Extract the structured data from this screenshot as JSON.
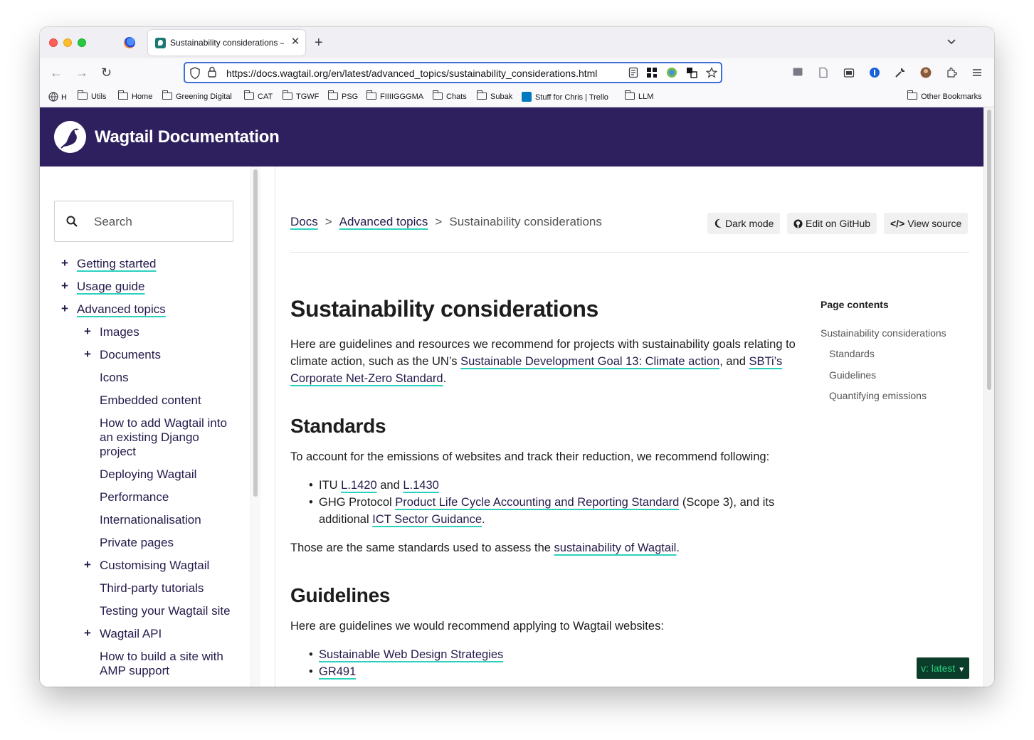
{
  "browser": {
    "tab_title": "Sustainability considerations —",
    "url": "https://docs.wagtail.org/en/latest/advanced_topics/sustainability_considerations.html",
    "bookmarks": [
      {
        "label": "H"
      },
      {
        "label": "Utils"
      },
      {
        "label": "Home"
      },
      {
        "label": "Greening Digital"
      },
      {
        "label": "CAT"
      },
      {
        "label": "TGWF"
      },
      {
        "label": "PSG"
      },
      {
        "label": "FIIIIGGGMA"
      },
      {
        "label": "Chats"
      },
      {
        "label": "Subak"
      },
      {
        "label": "Stuff for Chris | Trello"
      },
      {
        "label": "LLM"
      }
    ],
    "other_bookmarks": "Other Bookmarks"
  },
  "site": {
    "title": "Wagtail Documentation"
  },
  "sidebar": {
    "search_placeholder": "Search",
    "nav": [
      {
        "label": "Getting started"
      },
      {
        "label": "Usage guide"
      },
      {
        "label": "Advanced topics"
      },
      {
        "label": "Images"
      },
      {
        "label": "Documents"
      },
      {
        "label": "Icons"
      },
      {
        "label": "Embedded content"
      },
      {
        "label": "How to add Wagtail into an existing Django project"
      },
      {
        "label": "Deploying Wagtail"
      },
      {
        "label": "Performance"
      },
      {
        "label": "Internationalisation"
      },
      {
        "label": "Private pages"
      },
      {
        "label": "Customising Wagtail"
      },
      {
        "label": "Third-party tutorials"
      },
      {
        "label": "Testing your Wagtail site"
      },
      {
        "label": "Wagtail API"
      },
      {
        "label": "How to build a site with AMP support"
      }
    ]
  },
  "breadcrumb": {
    "docs": "Docs",
    "sep": ">",
    "advanced": "Advanced topics",
    "current": "Sustainability considerations"
  },
  "header_buttons": {
    "dark_mode": "Dark mode",
    "edit_github": "Edit on GitHub",
    "view_source": "View source"
  },
  "article": {
    "title": "Sustainability considerations",
    "intro_1": "Here are guidelines and resources we recommend for projects with sustainability goals relating to climate action, such as the UN’s ",
    "intro_link_1": "Sustainable Development Goal 13: Climate action",
    "intro_2": ", and ",
    "intro_link_2": "SBTi’s Corporate Net-Zero Standard",
    "intro_3": ".",
    "standards_heading": "Standards",
    "standards_intro": "To account for the emissions of websites and track their reduction, we recommend following:",
    "std_itu": "ITU ",
    "std_l1420": "L.1420",
    "std_and": " and ",
    "std_l1430": "L.1430",
    "std_ghg": "GHG Protocol ",
    "std_plc": "Product Life Cycle Accounting and Reporting Standard",
    "std_scope": " (Scope 3), and its additional ",
    "std_ict": "ICT Sector Guidance",
    "std_dot": ".",
    "standards_outro_1": "Those are the same standards used to assess the ",
    "standards_outro_link": "sustainability of Wagtail",
    "standards_outro_2": ".",
    "guidelines_heading": "Guidelines",
    "guidelines_intro": "Here are guidelines we would recommend applying to Wagtail websites:",
    "guide_1": "Sustainable Web Design Strategies",
    "guide_2": "GR491"
  },
  "toc": {
    "title": "Page contents",
    "items": [
      {
        "label": "Sustainability considerations"
      },
      {
        "label": "Standards"
      },
      {
        "label": "Guidelines"
      },
      {
        "label": "Quantifying emissions"
      }
    ]
  },
  "version_badge": "v: latest",
  "colors": {
    "header_bg": "#2e1f5e",
    "link_underline": "#2bd1bf",
    "link_text": "#261a4b",
    "badge_bg": "#0b3d2a",
    "badge_text": "#27d17d"
  }
}
